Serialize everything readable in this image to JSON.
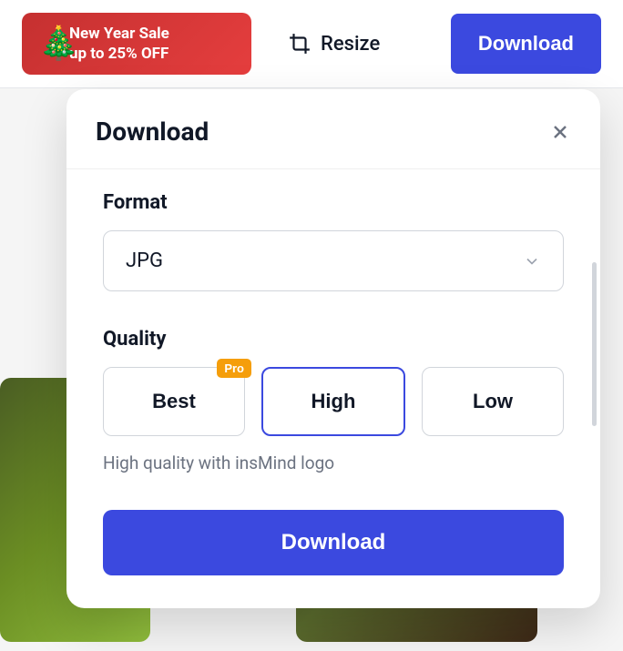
{
  "promo": {
    "line1": "New Year Sale",
    "line2": "up to 25% OFF"
  },
  "header": {
    "resize_label": "Resize",
    "download_label": "Download"
  },
  "modal": {
    "title": "Download",
    "format": {
      "label": "Format",
      "selected": "JPG"
    },
    "quality": {
      "label": "Quality",
      "options": [
        {
          "label": "Best",
          "selected": false,
          "pro": true
        },
        {
          "label": "High",
          "selected": true,
          "pro": false
        },
        {
          "label": "Low",
          "selected": false,
          "pro": false
        }
      ],
      "pro_badge": "Pro",
      "description": "High quality with insMind logo"
    },
    "download_button": "Download"
  }
}
